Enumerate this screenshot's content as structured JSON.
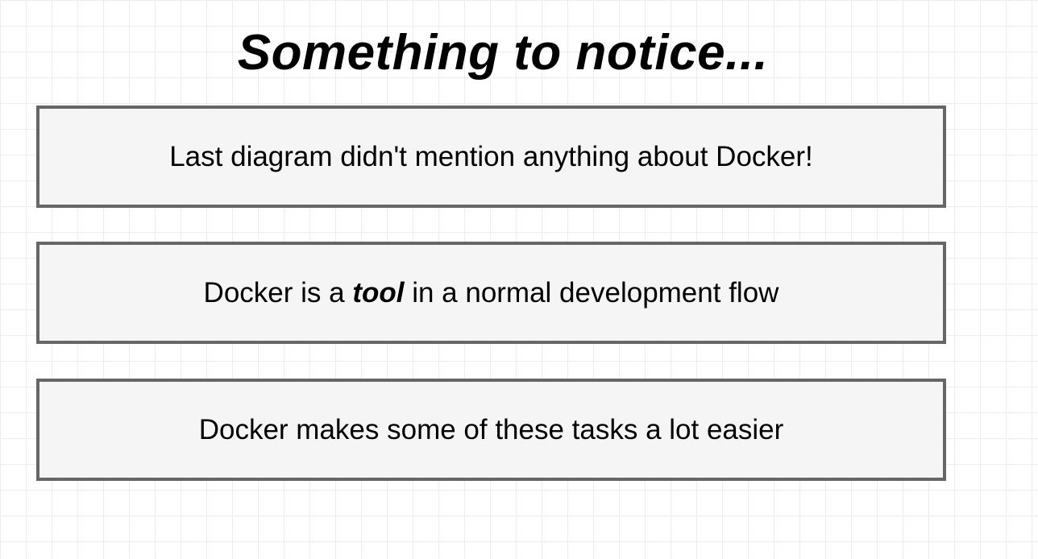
{
  "title": "Something to notice...",
  "boxes": [
    {
      "text": "Last diagram didn't mention anything about Docker!"
    },
    {
      "before": "Docker is a ",
      "emphasis": "tool",
      "after": " in a normal development flow"
    },
    {
      "text": "Docker makes some of these tasks a lot easier"
    }
  ]
}
